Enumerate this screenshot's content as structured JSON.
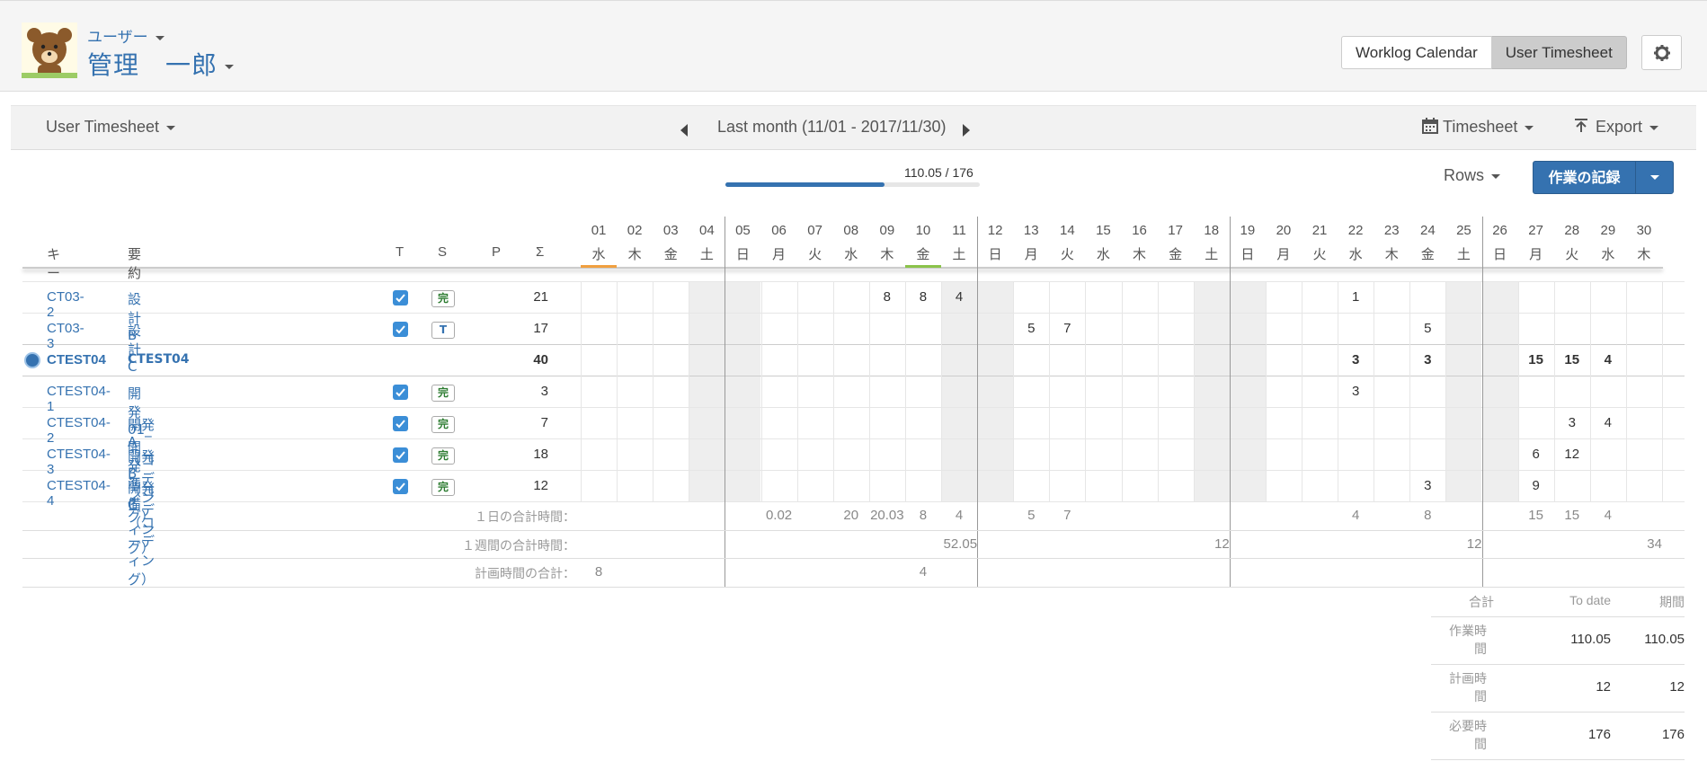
{
  "header": {
    "role": "ユーザー",
    "name": "管理　一郎",
    "buttons": [
      "Worklog Calendar",
      "User Timesheet"
    ],
    "active_button": "User Timesheet",
    "settings_icon": "gear-icon"
  },
  "toolbar": {
    "view": "User Timesheet",
    "period": "Last month (11/01 - 2017/11/30)",
    "timesheet": "Timesheet",
    "export": "Export"
  },
  "progress": {
    "label": "110.05 / 176",
    "fraction": 0.625
  },
  "rows_button": "Rows",
  "record_button": "作業の記録",
  "table": {
    "col_key": "キー",
    "col_summary": "要約",
    "col_t": "T",
    "col_s": "S",
    "col_p": "P",
    "col_sigma": "Σ",
    "days": [
      {
        "d": "01",
        "w": "水"
      },
      {
        "d": "02",
        "w": "木"
      },
      {
        "d": "03",
        "w": "金"
      },
      {
        "d": "04",
        "w": "土"
      },
      {
        "d": "05",
        "w": "日"
      },
      {
        "d": "06",
        "w": "月"
      },
      {
        "d": "07",
        "w": "火"
      },
      {
        "d": "08",
        "w": "水"
      },
      {
        "d": "09",
        "w": "木"
      },
      {
        "d": "10",
        "w": "金"
      },
      {
        "d": "11",
        "w": "土"
      },
      {
        "d": "12",
        "w": "日"
      },
      {
        "d": "13",
        "w": "月"
      },
      {
        "d": "14",
        "w": "火"
      },
      {
        "d": "15",
        "w": "水"
      },
      {
        "d": "16",
        "w": "木"
      },
      {
        "d": "17",
        "w": "金"
      },
      {
        "d": "18",
        "w": "土"
      },
      {
        "d": "19",
        "w": "日"
      },
      {
        "d": "20",
        "w": "月"
      },
      {
        "d": "21",
        "w": "火"
      },
      {
        "d": "22",
        "w": "水"
      },
      {
        "d": "23",
        "w": "木"
      },
      {
        "d": "24",
        "w": "金"
      },
      {
        "d": "25",
        "w": "土"
      },
      {
        "d": "26",
        "w": "日"
      },
      {
        "d": "27",
        "w": "月"
      },
      {
        "d": "28",
        "w": "火"
      },
      {
        "d": "29",
        "w": "水"
      },
      {
        "d": "30",
        "w": "木"
      }
    ],
    "rows": [
      {
        "key": "CT03-2",
        "summary": "設計B",
        "checked": true,
        "status": "完",
        "total": "21",
        "cells": {
          "09": "8",
          "10": "8",
          "11": "4",
          "22": "1"
        }
      },
      {
        "key": "CT03-3",
        "summary": "設計C",
        "checked": true,
        "status": "T",
        "total": "17",
        "cells": {
          "13": "5",
          "14": "7",
          "24": "5"
        }
      },
      {
        "key": "CTEST04",
        "summary": "CTEST04",
        "parent": true,
        "total": "40",
        "cells": {
          "22": "3",
          "24": "3",
          "27": "15",
          "28": "15",
          "29": "4"
        }
      },
      {
        "key": "CTEST04-1",
        "summary": "開発01_開発準備",
        "checked": true,
        "status": "完",
        "total": "3",
        "cells": {
          "22": "3"
        }
      },
      {
        "key": "CTEST04-2",
        "summary": "開発A（コーディング）",
        "checked": true,
        "status": "完",
        "total": "7",
        "cells": {
          "28": "3",
          "29": "4"
        }
      },
      {
        "key": "CTEST04-3",
        "summary": "開発B（コーディング）",
        "checked": true,
        "status": "完",
        "total": "18",
        "cells": {
          "27": "6",
          "28": "12"
        }
      },
      {
        "key": "CTEST04-4",
        "summary": "開発C（コーディング）",
        "checked": true,
        "status": "完",
        "total": "12",
        "cells": {
          "24": "3",
          "27": "9"
        }
      }
    ],
    "footer": {
      "daily_label": "１日の合計時間：",
      "daily": {
        "06": "0.02",
        "08": "20",
        "09": "20.03",
        "10": "8",
        "11": "4",
        "13": "5",
        "14": "7",
        "22": "4",
        "24": "8",
        "27": "15",
        "28": "15",
        "29": "4"
      },
      "weekly_label": "１週間の合計時間：",
      "weekly": {
        "11": "52.05",
        "18": "12",
        "25": "12",
        "30": "34"
      },
      "plan_label": "計画時間の合計：",
      "plan": {
        "01": "8",
        "10": "4"
      }
    }
  },
  "summary": {
    "headers": [
      "合計",
      "To date",
      "期間"
    ],
    "rows": [
      {
        "label": "作業時間",
        "to_date": "110.05",
        "period": "110.05"
      },
      {
        "label": "計画時間",
        "to_date": "12",
        "period": "12"
      },
      {
        "label": "必要時間",
        "to_date": "176",
        "period": "176"
      }
    ]
  }
}
